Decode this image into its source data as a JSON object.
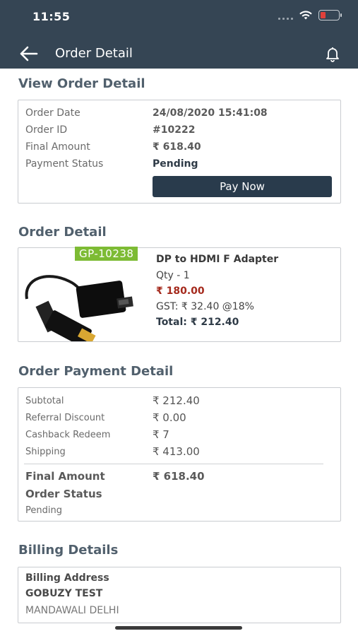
{
  "status_bar": {
    "time": "11:55"
  },
  "header": {
    "title": "Order Detail"
  },
  "view_order": {
    "section_title": "View Order Detail",
    "rows": [
      {
        "label": "Order Date",
        "value": "24/08/2020 15:41:08"
      },
      {
        "label": "Order ID",
        "value": "#10222"
      },
      {
        "label": "Final Amount",
        "value": "₹ 618.40"
      },
      {
        "label": "Payment Status",
        "value": "Pending"
      }
    ],
    "pay_button": "Pay Now"
  },
  "order_detail": {
    "section_title": "Order Detail",
    "item": {
      "sku": "GP-10238",
      "name": "DP to HDMI F Adapter",
      "qty": "Qty - 1",
      "price": "₹ 180.00",
      "gst": "GST: ₹ 32.40 @18%",
      "total": "Total: ₹ 212.40"
    }
  },
  "payment_detail": {
    "section_title": "Order Payment Detail",
    "rows": [
      {
        "label": "Subtotal",
        "value": "₹ 212.40"
      },
      {
        "label": "Referral Discount",
        "value": "₹ 0.00"
      },
      {
        "label": "Cashback Redeem",
        "value": "₹ 7"
      },
      {
        "label": "Shipping",
        "value": "₹ 413.00"
      }
    ],
    "final_label": "Final Amount",
    "final_value": "₹ 618.40",
    "order_status_label": "Order Status",
    "order_status_value": "Pending"
  },
  "billing": {
    "section_title": "Billing Details",
    "address_label": "Billing Address",
    "name": "GOBUZY TEST",
    "address_line": "MANDAWALI DELHI"
  },
  "colors": {
    "header_bg": "#354554",
    "button_bg": "#293b4c",
    "sku_badge": "#7dbb34",
    "price_red": "#a52a1d",
    "battery_low": "#e0403a"
  },
  "icons": [
    "back-arrow-icon",
    "bell-icon",
    "wifi-icon",
    "battery-icon",
    "signal-icon"
  ]
}
